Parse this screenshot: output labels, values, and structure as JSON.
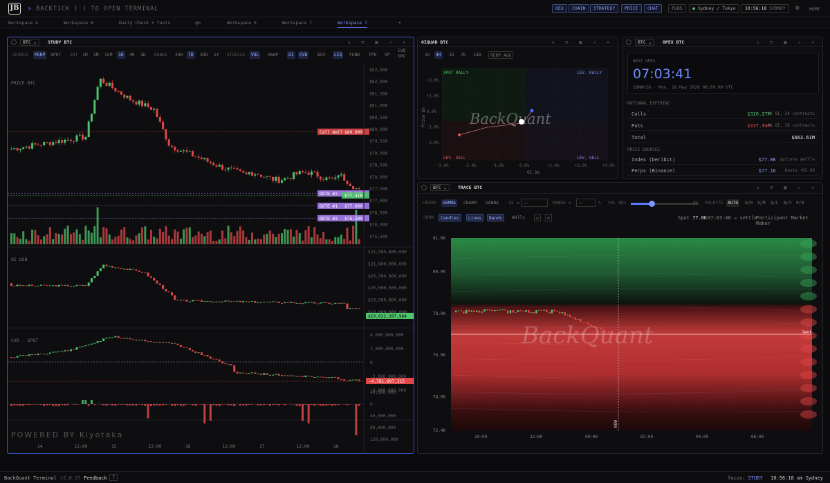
{
  "app": {
    "logo": "JB",
    "terminal_prompt": ">",
    "terminal_text": "BACKTICK (`) TO OPEN TERMINAL"
  },
  "topnav": {
    "buttons": [
      "GEX",
      "CHAIN",
      "STRATEGY",
      "PRICE",
      "CHAT"
    ],
    "flds": "FLDS",
    "session": "Sydney / Tokyo",
    "clock": "10:56:18",
    "clock_zone": "SYDNEY",
    "home": "HOME"
  },
  "tabs": [
    "Workspace 4",
    "Workspace 6",
    "Daily Check + Tools",
    "gm",
    "Workspace 5",
    "Workspace 7",
    "Workspace 7",
    "+"
  ],
  "study": {
    "symbol": "BTC",
    "title": "STUDY BTC",
    "toolbar": {
      "source_label": "SOURCE",
      "sources": [
        "PERP",
        "SPOT"
      ],
      "int_label": "INT",
      "intervals": [
        "1M",
        "5M",
        "15M",
        "1H",
        "4H",
        "1D"
      ],
      "range_label": "RANGE",
      "ranges": [
        "24H",
        "7D",
        "30D",
        "1Y"
      ],
      "studies_label": "STUDIES",
      "studies": [
        "VOL",
        "VWAP",
        "OI",
        "CVD",
        "BSV",
        "LIQ",
        "FUND",
        "TPO",
        "VP",
        "CVD SRC"
      ]
    },
    "price_label": "PRICE BTC",
    "price_axis": [
      "$82,500",
      "$82,000",
      "$81,500",
      "$81,000",
      "$80,500",
      "$80,000",
      "$79,500",
      "$79,000",
      "$78,500",
      "$78,000",
      "$77,500",
      "$77,000",
      "$76,500",
      "$76,000",
      "$75,500"
    ],
    "levels": [
      {
        "label": "Call Wall",
        "value": "$80,000",
        "color": "#e04848"
      },
      {
        "label": "OOTE #2",
        "value": "$77,500",
        "color": "#a77bf0"
      },
      {
        "label": "",
        "value": "$77,418",
        "color": "#4fc36b"
      },
      {
        "label": "OOTE #1",
        "value": "$77,000",
        "color": "#a77bf0"
      },
      {
        "label": "OOTE #3",
        "value": "$76,500",
        "color": "#a77bf0"
      }
    ],
    "oi_label": "OI USD",
    "oi_axis": [
      "$21,500,000,000",
      "$21,000,000,000",
      "$20,500,000,000",
      "$20,000,000,000",
      "$19,500,000,000",
      "$19,000,000,000"
    ],
    "oi_last": "$19,022,397,984",
    "cvd_label": "CVD · SPOT",
    "cvd_axis": [
      "4,000,000,000",
      "2,000,000,000",
      "0",
      "-2,000,000,000",
      "-4,000,000,000"
    ],
    "cvd_last": "-4,781,897,215",
    "liq_axis": [
      "40,000,000",
      "0",
      "40,000,000",
      "80,000,000",
      "120,000,000"
    ],
    "watermark": "POWERED BY Kiyotaka",
    "x_axis": [
      "14",
      "12:00",
      "15",
      "12:00",
      "16",
      "12:00",
      "17",
      "12:00",
      "18"
    ]
  },
  "oiquad": {
    "title": "OIQUAD BTC",
    "intervals": [
      "1H",
      "4H",
      "1D",
      "7D",
      "14D",
      "PERP AGG"
    ],
    "q_tl": "SPOT RALLY",
    "q_tr": "LEV. RALLY",
    "q_bl": "LEV. SELL",
    "q_br": "LEV. SELL",
    "y_axis": [
      "+2.0%",
      "+1.0%",
      "0.0%",
      "-1.0%",
      "-2.0%"
    ],
    "x_axis": [
      "-3.0%",
      "-2.0%",
      "-1.0%",
      "0.0%",
      "+1.0%",
      "+2.0%",
      "+3.0%"
    ],
    "ylabel": "Price Δ%",
    "xlabel": "OI Δ%",
    "watermark": "BackQuant"
  },
  "opex": {
    "symbol": "BTC",
    "title": "OPEX BTC",
    "next_label": "NEXT OPEX",
    "countdown": "07:03:41",
    "date": "18MAY26 · Mon, 18 May 2026 08:00:00 UTC",
    "notional_label": "NOTIONAL EXPIRING",
    "rows": [
      {
        "label": "Calls",
        "value": "$326.27M",
        "detail": "4.1K OI, 34 contracts"
      },
      {
        "label": "Puts",
        "value": "$337.34M",
        "detail": "4.4K OI, 38 contracts"
      },
      {
        "label": "Total",
        "value": "$663.61M",
        "detail": ""
      }
    ],
    "sources_label": "PRICE SOURCES",
    "sources": [
      {
        "label": "Index (Deribit)",
        "value": "$77.0K",
        "detail": "options settle"
      },
      {
        "label": "Perps (Binance)",
        "value": "$77.1K",
        "detail": "basis +92.09"
      }
    ]
  },
  "trace": {
    "symbol": "BTC",
    "title": "TRACE BTC",
    "greek_label": "GREEK",
    "greeks": [
      "GAMMA",
      "CHARM",
      "VANNA"
    ],
    "oi_label": "OI ≥",
    "range_label": "RANGE ±",
    "pct": "%",
    "voladj_label": "VOL ADJ",
    "voladj_value": "0%",
    "palette_label": "PALETTE",
    "palettes": [
      "AUTO",
      "G/R",
      "A/M",
      "A/C",
      "B/Y",
      "P/O"
    ],
    "show_label": "SHOW",
    "show": [
      "Candles",
      "Lines",
      "Bands",
      "Walls"
    ],
    "spot_label": "Spot",
    "spot_value": "77.0K",
    "settle": "07:03:40 → settle",
    "participant": "Participant Market Maker",
    "y_axis": [
      "81.6K",
      "80.0K",
      "78.0K",
      "76.0K",
      "74.0K",
      "72.4K"
    ],
    "x_axis": [
      "20:00",
      "22:00",
      "00:00",
      "02:00",
      "04:00",
      "06:00"
    ],
    "now": "NOW",
    "watermark": "BackQuant",
    "spot_tag": "Spot"
  },
  "footer": {
    "brand": "BackQuant Terminal",
    "version": "v2.0.57",
    "feedback": "Feedback",
    "help": "?",
    "focus_label": "focus:",
    "focus_value": "STUDY",
    "clock": "10:56:18 am Sydney"
  },
  "colors": {
    "accent": "#5c7cff",
    "up": "#4fc36b",
    "down": "#e04848",
    "purple": "#a77bf0"
  }
}
